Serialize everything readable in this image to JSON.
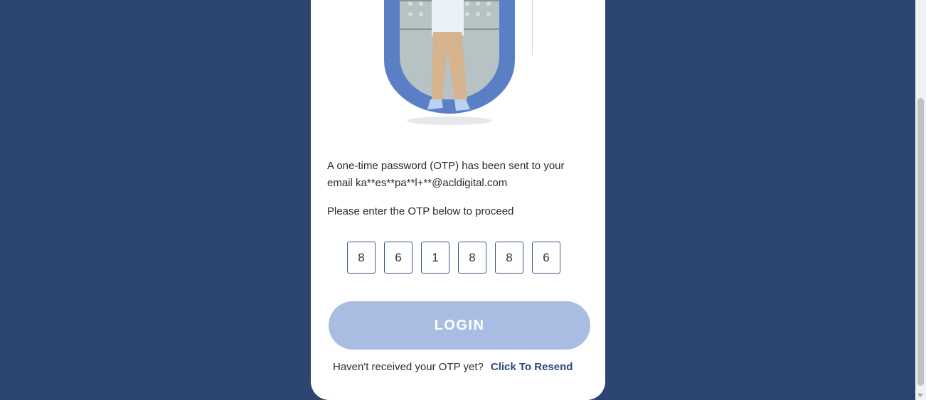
{
  "message": {
    "line1": "A one-time password (OTP) has been sent to your",
    "line2": "email ka**es**pa**l+**@acldigital.com",
    "instruction": "Please enter the OTP below to proceed"
  },
  "otp": {
    "digits": [
      "8",
      "6",
      "1",
      "8",
      "8",
      "6"
    ]
  },
  "login_button": {
    "label": "LOGIN"
  },
  "resend": {
    "prompt": "Haven't received your OTP yet?",
    "link": "Click To Resend"
  },
  "colors": {
    "background": "#2c4570",
    "button": "#a9bde3",
    "accent_arch": "#5b7fc4"
  }
}
